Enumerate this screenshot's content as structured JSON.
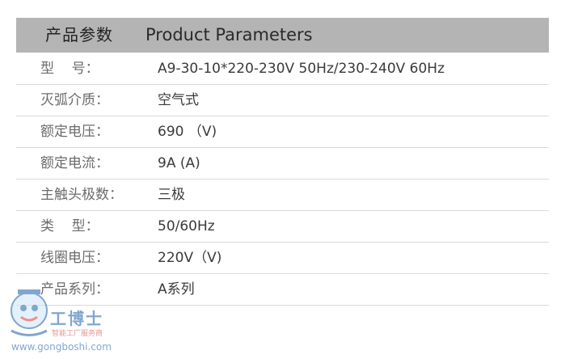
{
  "header": {
    "title_cn": "产品参数",
    "title_en": "Product Parameters"
  },
  "params": [
    {
      "label": "型    号：",
      "value": "A9-30-10*220-230V 50Hz/230-240V 60Hz"
    },
    {
      "label": "灭弧介质：",
      "value": "空气式"
    },
    {
      "label": "额定电压：",
      "value": "690 （V)"
    },
    {
      "label": "额定电流：",
      "value": "9A (A)"
    },
    {
      "label": "主触头极数：",
      "value": "三极"
    },
    {
      "label": "类    型：",
      "value": "50/60Hz"
    },
    {
      "label": "线圈电压：",
      "value": "220V（V)"
    },
    {
      "label": "产品系列：",
      "value": "A系列"
    }
  ],
  "watermark": {
    "brand": "工博士",
    "tagline": "智能工厂服务商",
    "url": "www.gongboshi.com"
  },
  "colors": {
    "header_bg": "#b4b4b4",
    "divider": "#d9d9d9",
    "label_text": "#6b6b6b",
    "value_text": "#3a3a3a",
    "brand_blue": "#1c5fa8",
    "brand_red": "#d53b2f"
  }
}
